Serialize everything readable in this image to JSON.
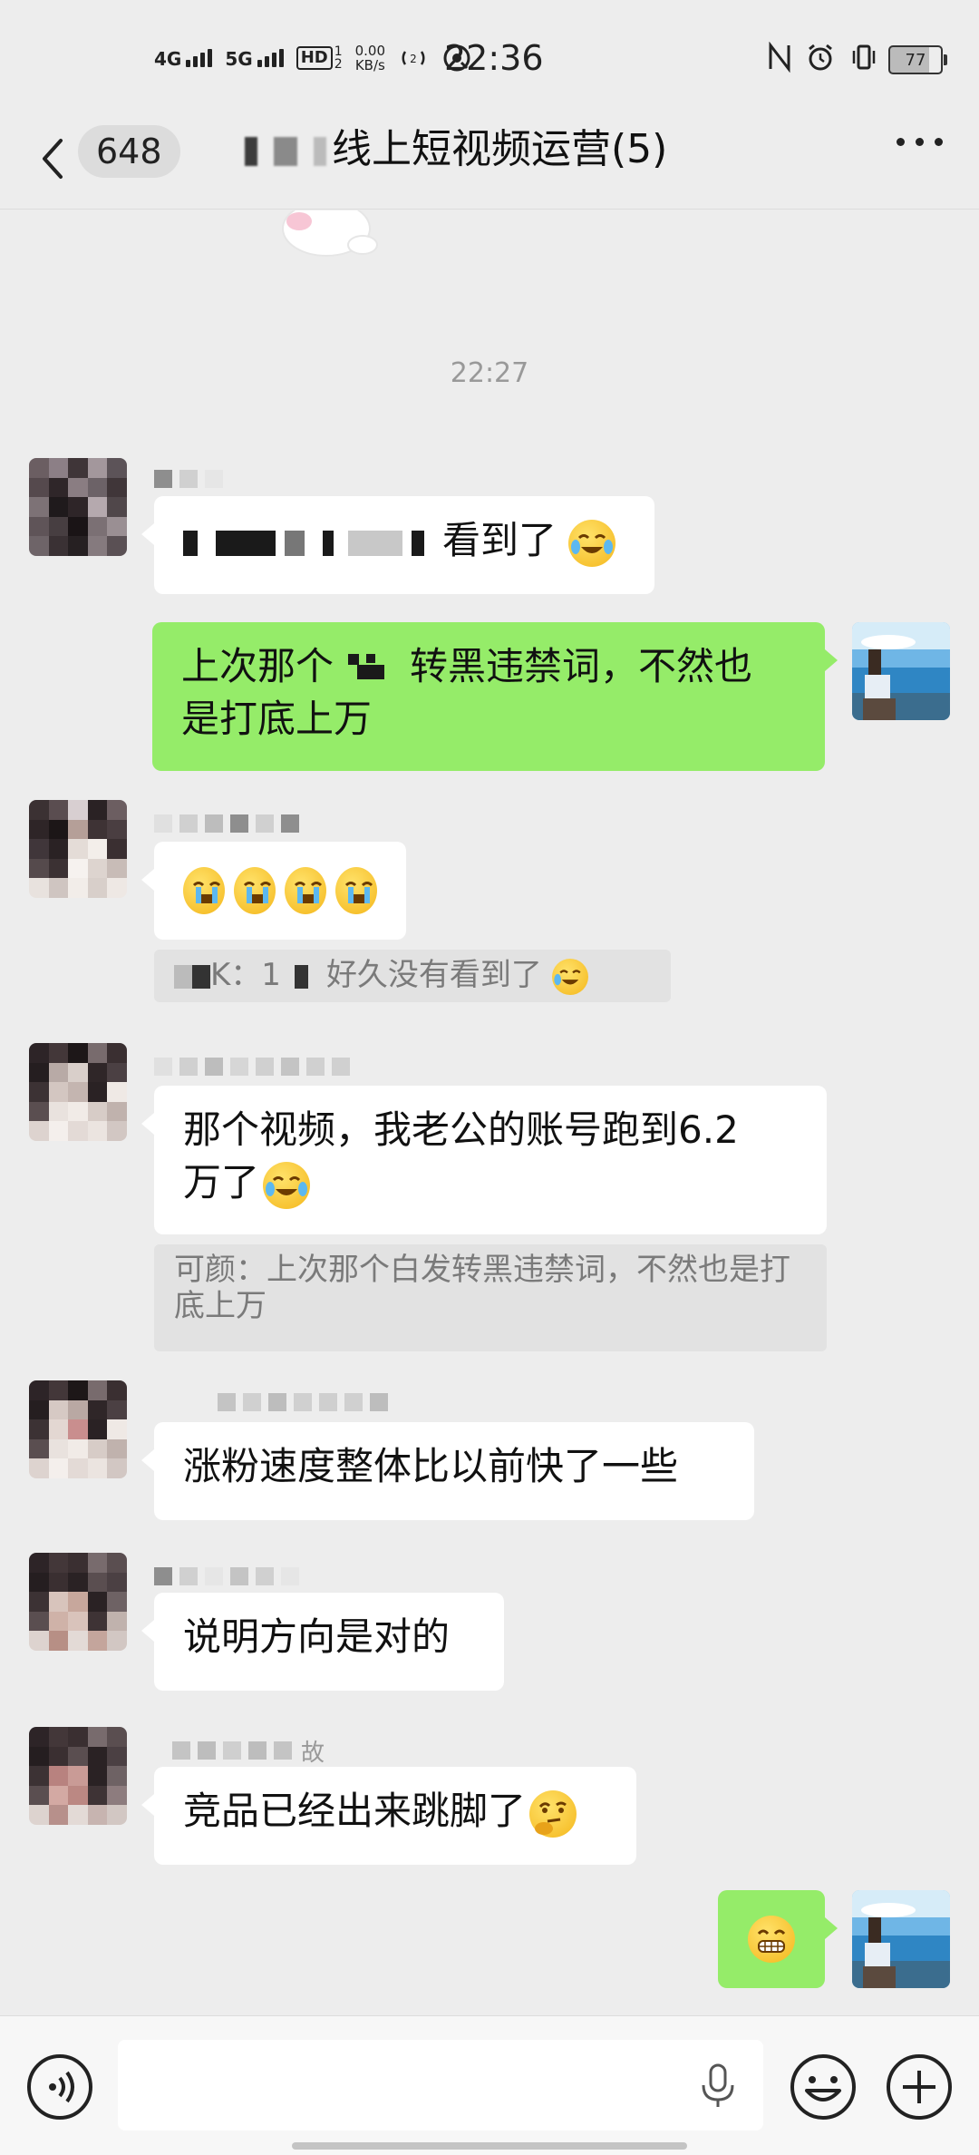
{
  "status_bar": {
    "net_4g": "4G",
    "net_5g": "5G",
    "hd": "HD",
    "hd_sub": "1",
    "hd_sub2": "2",
    "speed_value": "0.00",
    "speed_unit": "KB/s",
    "time": "22:36",
    "battery": "77"
  },
  "header": {
    "back_count": "648",
    "title_visible": "线上短视频运营(5)",
    "more_label": "更多"
  },
  "timestamp": "22:27",
  "messages": [
    {
      "side": "in",
      "text_visible": "看到了",
      "emoji": "laughing-crying-emoji"
    },
    {
      "side": "out",
      "text_line1_a": "上次那个",
      "text_line1_b": "转黑违禁词，不然也",
      "text_line2": "是打底上万"
    },
    {
      "side": "in",
      "emoji": "crying-emoji",
      "emoji_count": "4"
    },
    {
      "side": "quote",
      "prefix": "K：1",
      "text": "好久没有看到了"
    },
    {
      "side": "in",
      "text": "那个视频，我老公的账号跑到6.2\n万了"
    },
    {
      "side": "quote",
      "text": "可颜：上次那个白发转黑违禁词，不然也是打底上万"
    },
    {
      "side": "in",
      "text": "涨粉速度整体比以前快了一些"
    },
    {
      "side": "in",
      "text": "说明方向是对的"
    },
    {
      "side": "in",
      "text": "竞品已经出来跳脚了",
      "emoji": "thinking-emoji"
    },
    {
      "side": "out",
      "emoji": "grinning-emoji"
    }
  ],
  "nick_fragment": "故",
  "input_bar": {
    "placeholder": "",
    "voice_icon": "voice-icon",
    "mic_icon": "mic-icon",
    "emoji_icon": "emoji-icon",
    "plus_icon": "plus-icon"
  }
}
